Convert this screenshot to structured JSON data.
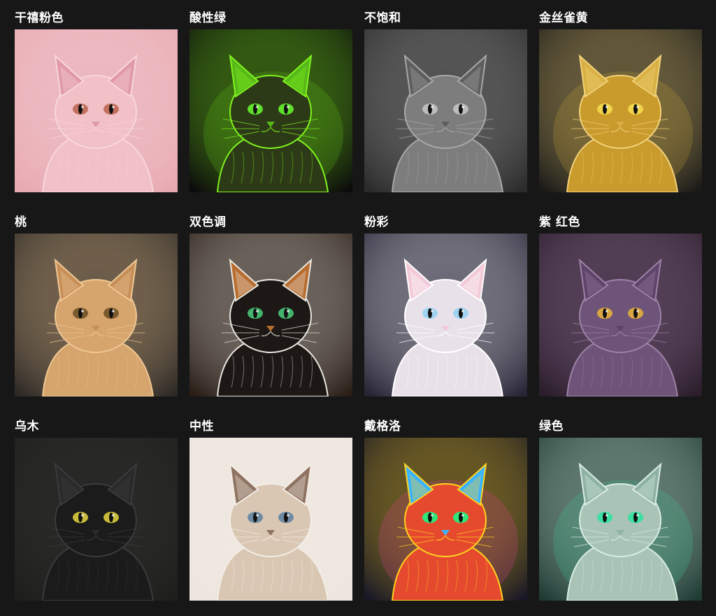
{
  "styles": [
    {
      "id": "pink",
      "label": "干禧粉色",
      "bg": "#e7a9b1",
      "body": "#f2c0c7",
      "ear": "#e09aa6",
      "eye": "#c3715e",
      "stroke": "#f8d7dc",
      "glow": "none"
    },
    {
      "id": "acid",
      "label": "酸性绿",
      "bg": "#0c0c0c",
      "body": "#2d3a17",
      "ear": "#58b81a",
      "eye": "#5fe02a",
      "stroke": "#7ff21e",
      "glow": "#6fdc17"
    },
    {
      "id": "desat",
      "label": "不饱和",
      "bg": "#2b2b2b",
      "body": "#7d7d7d",
      "ear": "#5e5e5e",
      "eye": "#bdbdbd",
      "stroke": "#a8a8a8",
      "glow": "none"
    },
    {
      "id": "gold",
      "label": "金丝雀黄",
      "bg": "#1a1a18",
      "body": "#c99a2c",
      "ear": "#d9b043",
      "eye": "#f0d44a",
      "stroke": "#f2d27a",
      "glow": "#e5b53a"
    },
    {
      "id": "peach",
      "label": "桃",
      "bg": "#2e2a26",
      "body": "#d6a46d",
      "ear": "#c68f58",
      "eye": "#7b5b2e",
      "stroke": "#efc794",
      "glow": "none"
    },
    {
      "id": "duotone",
      "label": "双色调",
      "bg": "#2a1e17",
      "body": "#1d1815",
      "ear": "#b86c2d",
      "eye": "#43b46e",
      "stroke": "#e8e6e0",
      "glow": "none"
    },
    {
      "id": "pastel",
      "label": "粉彩",
      "bg": "#272436",
      "body": "#e9e1ea",
      "ear": "#f2c9d8",
      "eye": "#9fd3ef",
      "stroke": "#ffffff",
      "glow": "none"
    },
    {
      "id": "magenta",
      "label": "紫 红色",
      "bg": "#2b1d2b",
      "body": "#6e5478",
      "ear": "#5d4468",
      "eye": "#d8a742",
      "stroke": "#9f81a8",
      "glow": "none"
    },
    {
      "id": "ebony",
      "label": "乌木",
      "bg": "#1e1e1c",
      "body": "#1b1b1b",
      "ear": "#2a2a2a",
      "eye": "#c9bb3a",
      "stroke": "#3b3b3b",
      "glow": "none"
    },
    {
      "id": "neutral",
      "label": "中性",
      "bg": "#ece6de",
      "body": "#d9c7b3",
      "ear": "#8e7361",
      "eye": "#6e8ba3",
      "stroke": "#f3ede6",
      "glow": "none"
    },
    {
      "id": "dayglow",
      "label": "戴格洛",
      "bg": "#191826",
      "body": "#e64a2e",
      "ear": "#3bb4ff",
      "eye": "#2fe67a",
      "stroke": "#ffd21f",
      "glow": "#ff3fa4"
    },
    {
      "id": "green",
      "label": "绿色",
      "bg": "#1f3b33",
      "body": "#a9c3b7",
      "ear": "#8fb2a3",
      "eye": "#3be0a2",
      "stroke": "#d9ece4",
      "glow": "#3be0a2"
    }
  ]
}
